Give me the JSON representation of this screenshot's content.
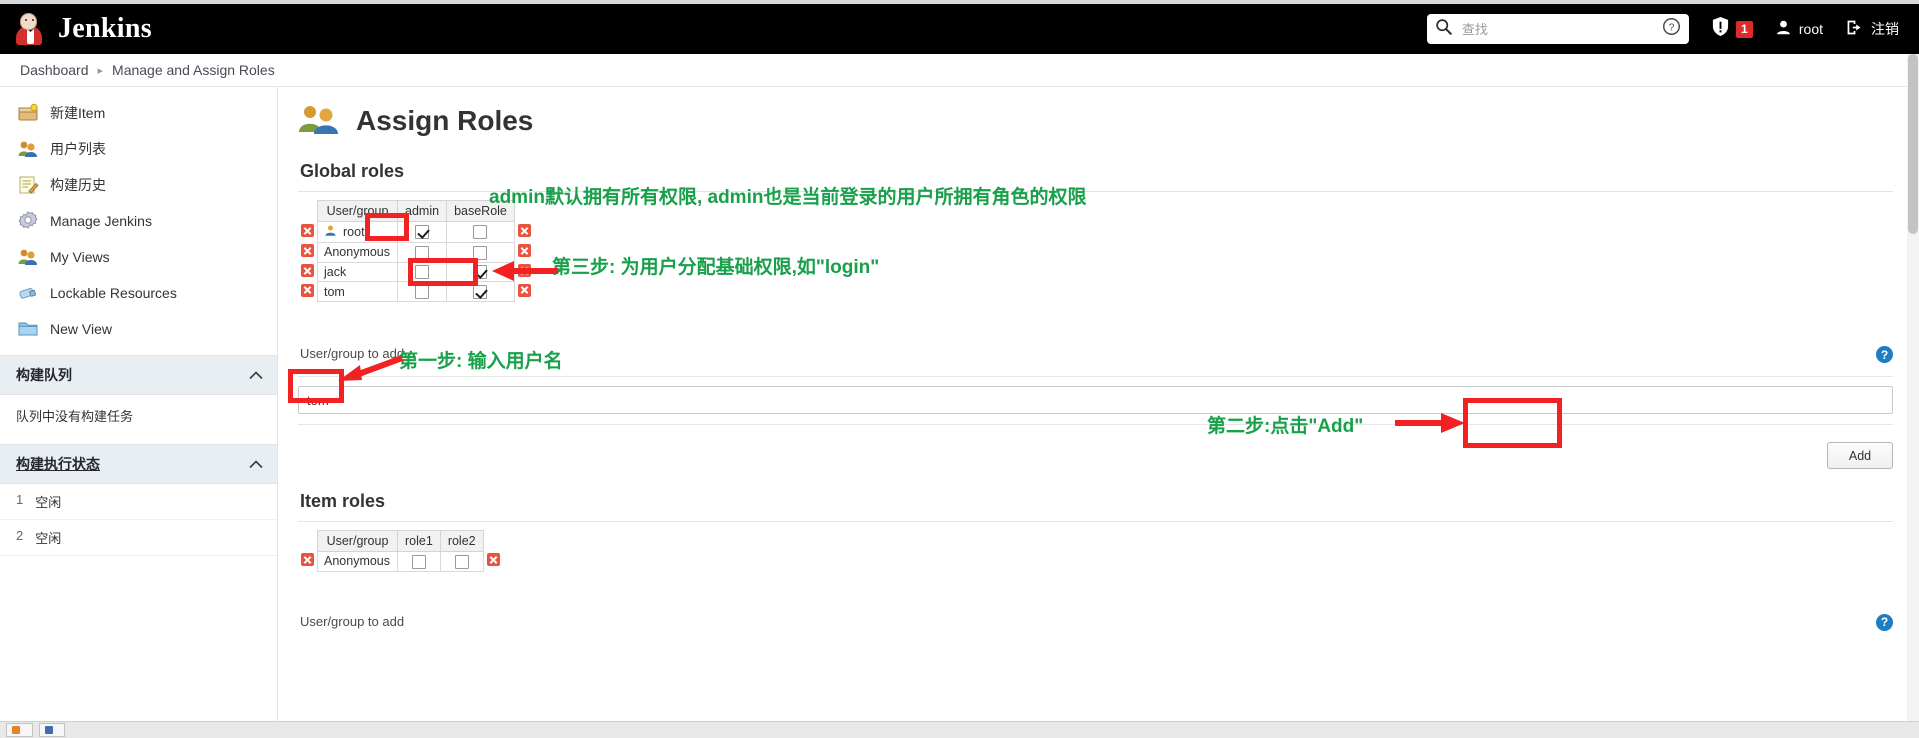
{
  "header": {
    "brand": "Jenkins",
    "logo_icon": "jenkins-butler-icon",
    "search": {
      "placeholder": "查找",
      "value": "",
      "icon": "search-icon",
      "help_icon": "help-circle-icon"
    },
    "security_warning": {
      "icon": "shield-alert-icon",
      "count": "1"
    },
    "user": {
      "icon": "user-icon",
      "name": "root"
    },
    "logout": {
      "icon": "logout-icon",
      "label": "注销"
    }
  },
  "breadcrumb": {
    "items": [
      "Dashboard",
      "Manage and Assign Roles"
    ],
    "separator": "▸"
  },
  "sidebar": {
    "items": [
      {
        "label": "新建Item",
        "icon": "new-item-icon"
      },
      {
        "label": "用户列表",
        "icon": "people-icon"
      },
      {
        "label": "构建历史",
        "icon": "build-history-icon"
      },
      {
        "label": "Manage Jenkins",
        "icon": "gear-icon"
      },
      {
        "label": "My Views",
        "icon": "people-icon"
      },
      {
        "label": "Lockable Resources",
        "icon": "lock-resource-icon"
      },
      {
        "label": "New View",
        "icon": "folder-icon"
      }
    ],
    "build_queue": {
      "title": "构建队列",
      "collapse_icon": "chevron-up-icon",
      "empty_text": "队列中没有构建任务"
    },
    "build_executor": {
      "title": "构建执行状态",
      "collapse_icon": "chevron-up-icon",
      "executors": [
        {
          "num": "1",
          "status": "空闲"
        },
        {
          "num": "2",
          "status": "空闲"
        }
      ]
    }
  },
  "main": {
    "page_title": "Assign Roles",
    "page_icon": "assign-roles-icon",
    "global_roles": {
      "section_title": "Global roles",
      "columns": [
        "User/group",
        "admin",
        "baseRole"
      ],
      "rows": [
        {
          "user": "root",
          "has_user_icon": true,
          "admin": true,
          "baseRole": false
        },
        {
          "user": "Anonymous",
          "has_user_icon": false,
          "admin": false,
          "baseRole": false
        },
        {
          "user": "jack",
          "has_user_icon": false,
          "admin": false,
          "baseRole": true
        },
        {
          "user": "tom",
          "has_user_icon": false,
          "admin": false,
          "baseRole": true
        }
      ],
      "delete_icon": "delete-x-icon"
    },
    "add_user_global": {
      "label": "User/group to add",
      "input_value": "tom",
      "input_placeholder": "",
      "add_button": "Add",
      "help_icon": "help-icon"
    },
    "item_roles": {
      "section_title": "Item roles",
      "columns": [
        "User/group",
        "role1",
        "role2"
      ],
      "rows": [
        {
          "user": "Anonymous",
          "has_user_icon": false,
          "role1": false,
          "role2": false
        }
      ],
      "delete_icon": "delete-x-icon"
    },
    "add_user_item": {
      "label": "User/group to add",
      "help_icon": "help-icon"
    }
  },
  "annotations": [
    {
      "id": "anno-admin",
      "text": "admin默认拥有所有权限, admin也是当前登录的用户所拥有角色的权限"
    },
    {
      "id": "anno-step3",
      "text": "第三步: 为用户分配基础权限,如\"login\""
    },
    {
      "id": "anno-step1",
      "text": "第一步: 输入用户名"
    },
    {
      "id": "anno-step2",
      "text": "第二步:点击\"Add\""
    }
  ],
  "colors": {
    "annotation_text": "#18a04a",
    "annotation_box": "#f22222",
    "badge": "#e02a2a",
    "header_bg": "#000000"
  }
}
